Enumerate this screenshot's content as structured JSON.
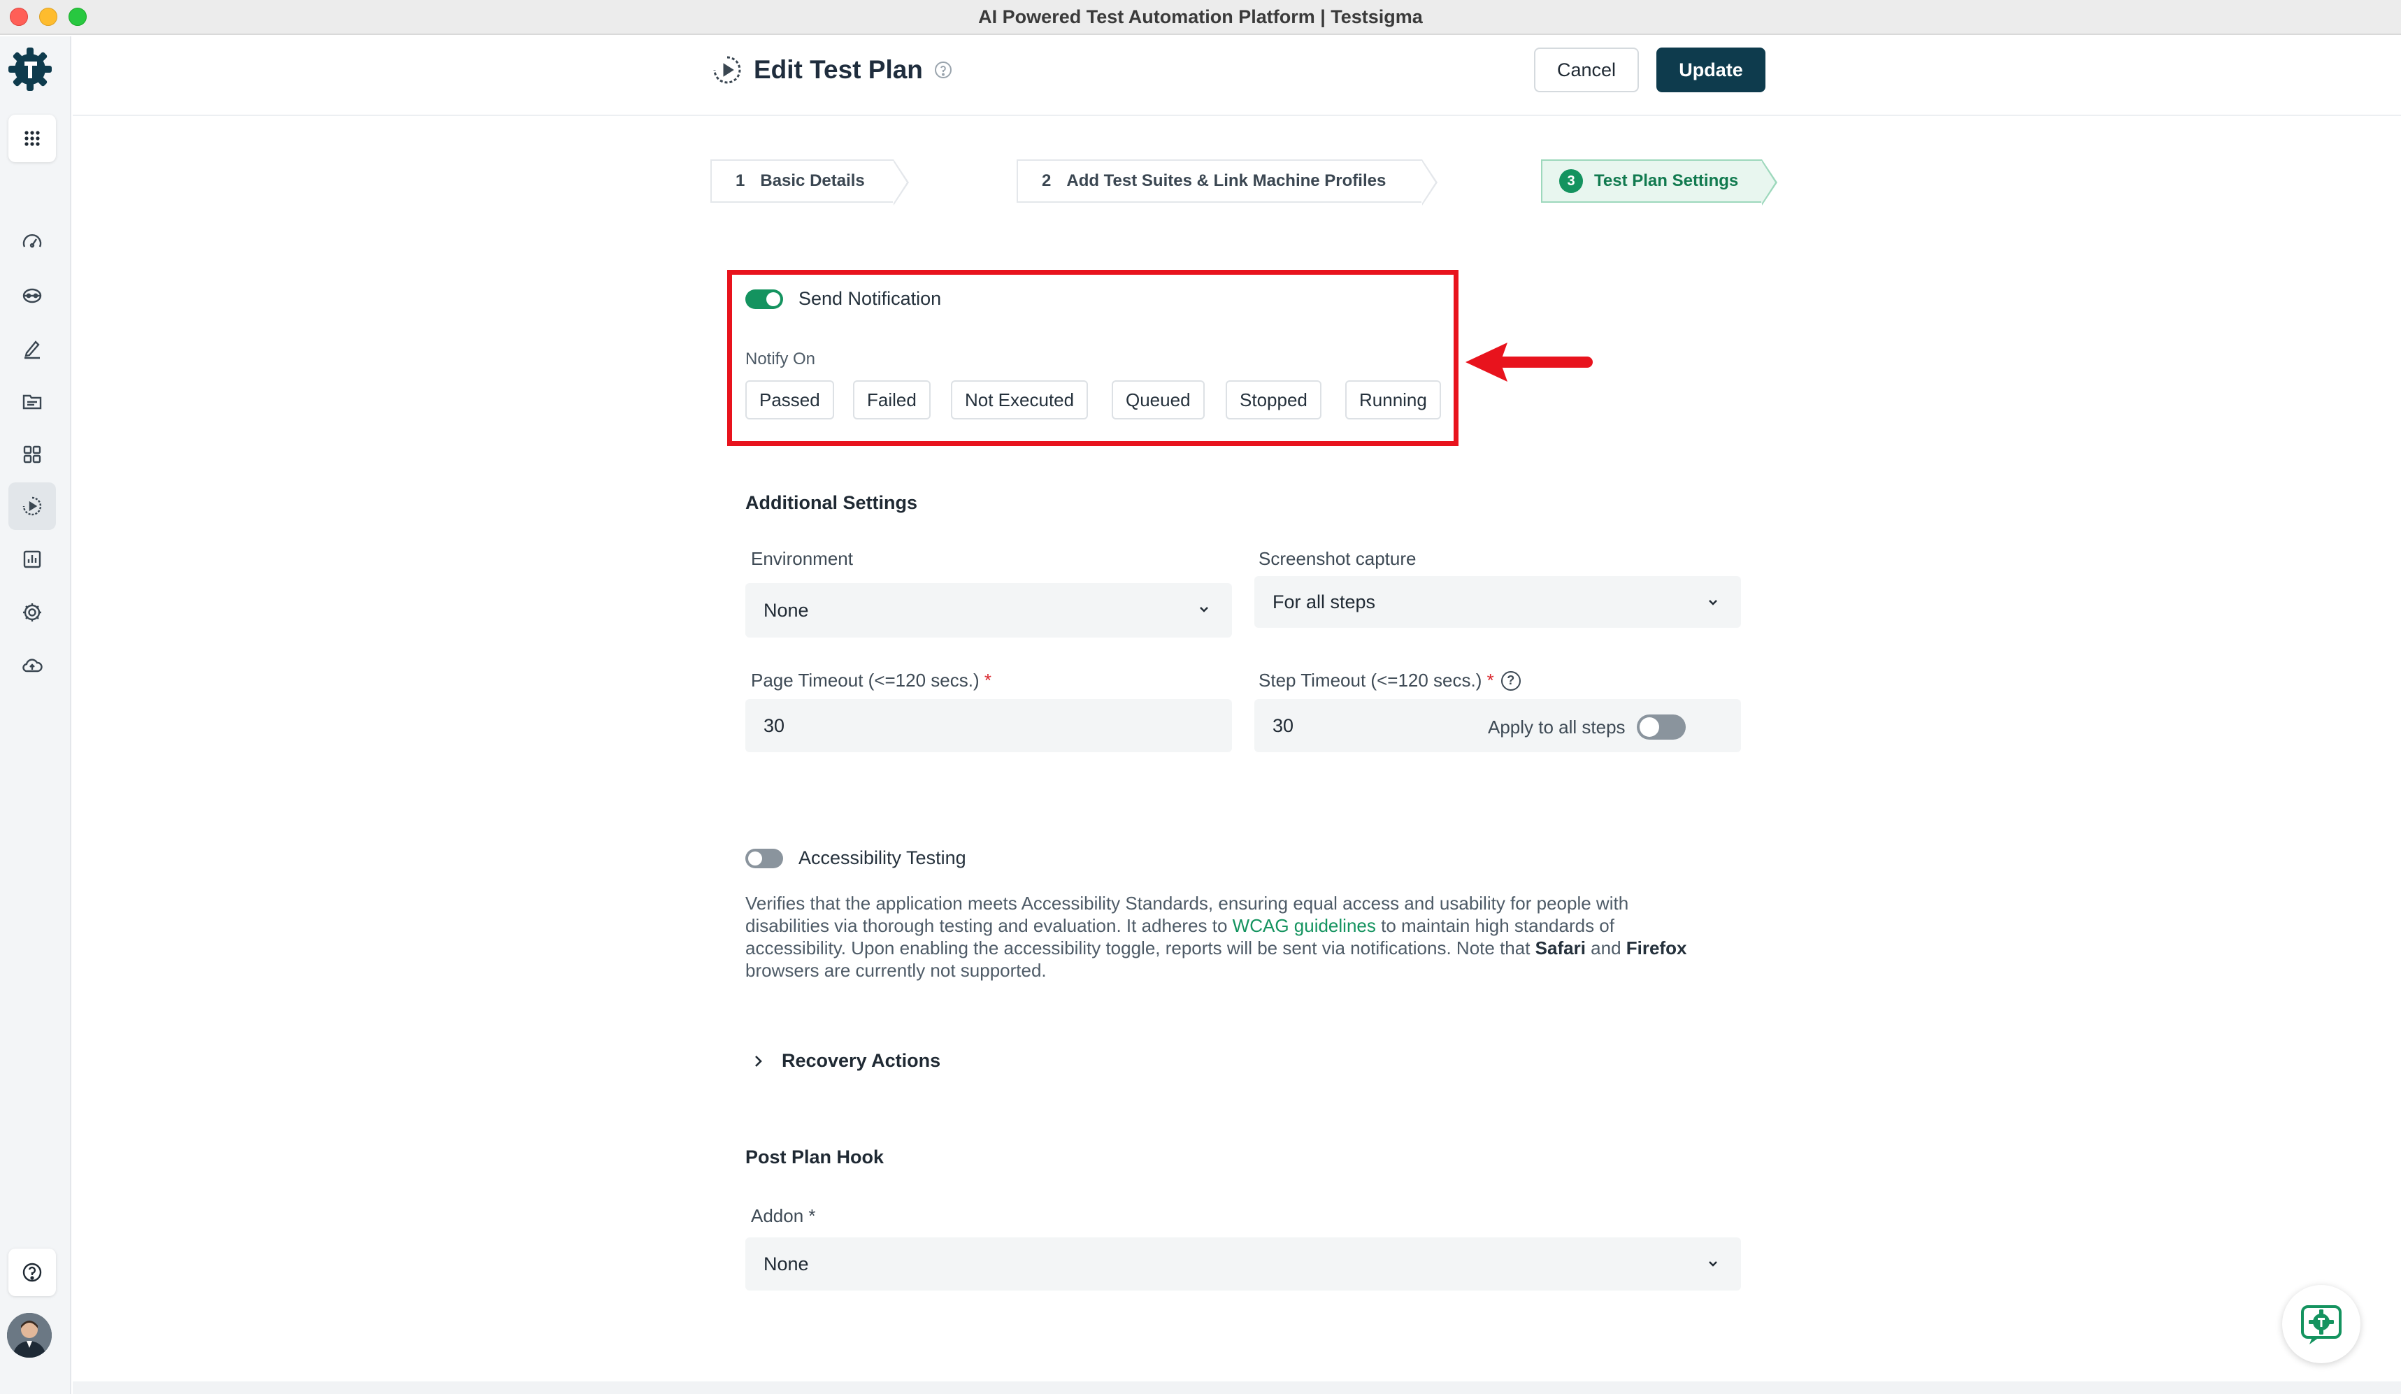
{
  "window": {
    "title": "AI Powered Test Automation Platform | Testsigma"
  },
  "header": {
    "title": "Edit Test Plan",
    "cancel_label": "Cancel",
    "update_label": "Update"
  },
  "steps": [
    {
      "number": "1",
      "label": "Basic Details",
      "active": false
    },
    {
      "number": "2",
      "label": "Add Test Suites & Link Machine Profiles",
      "active": false
    },
    {
      "number": "3",
      "label": "Test Plan Settings",
      "active": true
    }
  ],
  "notification": {
    "label": "Send Notification",
    "enabled": true,
    "notify_on_label": "Notify On",
    "options": [
      "Passed",
      "Failed",
      "Not Executed",
      "Queued",
      "Stopped",
      "Running"
    ]
  },
  "additional_settings": {
    "title": "Additional Settings",
    "environment": {
      "label": "Environment",
      "value": "None"
    },
    "screenshot_capture": {
      "label": "Screenshot capture",
      "value": "For all steps"
    },
    "page_timeout": {
      "label": "Page Timeout (<=120 secs.)",
      "required_mark": "*",
      "value": "30"
    },
    "step_timeout": {
      "label": "Step Timeout (<=120 secs.)",
      "required_mark": "*",
      "value": "30",
      "apply_all_label": "Apply to all steps",
      "apply_all_enabled": false
    }
  },
  "accessibility": {
    "label": "Accessibility Testing",
    "enabled": false,
    "desc_1": "Verifies that the application meets Accessibility Standards, ensuring equal access and usability for people with disabilities via thorough testing and evaluation. It adheres to ",
    "desc_link": "WCAG guidelines",
    "desc_2": " to maintain high standards of accessibility. Upon enabling the accessibility toggle, reports will be sent via notifications. Note that ",
    "desc_safari": "Safari",
    "desc_and": " and ",
    "desc_firefox": "Firefox",
    "desc_3": " browsers are currently not supported."
  },
  "recovery_actions": {
    "label": "Recovery Actions"
  },
  "post_plan_hook": {
    "title": "Post Plan Hook",
    "addon_label": "Addon",
    "addon_required_mark": "*",
    "addon_value": "None"
  },
  "sidebar": {
    "icons": [
      "apps-grid-icon",
      "dashboard-icon",
      "robot-icon",
      "edit-icon",
      "test-suites-icon",
      "addons-grid-icon",
      "test-plans-icon",
      "reports-icon",
      "settings-icon",
      "cloud-icon",
      "help-icon"
    ]
  },
  "colors": {
    "accent": "#14935f",
    "primary_button": "#0e3b4d",
    "highlight": "#e8131d"
  }
}
